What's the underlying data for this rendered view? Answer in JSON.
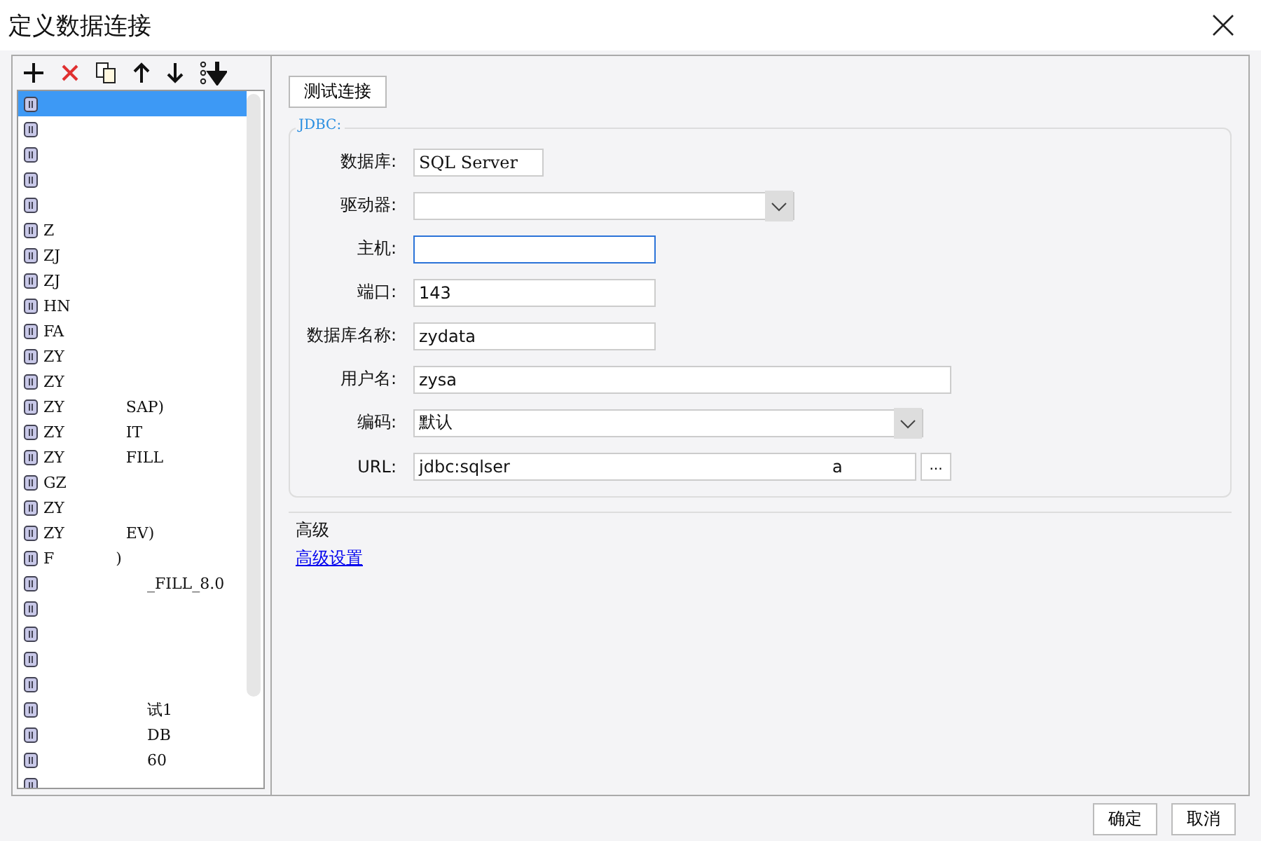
{
  "window": {
    "title": "定义数据连接"
  },
  "connections": [
    {
      "selected": true
    },
    {
      "selected": false
    },
    {
      "selected": false
    },
    {
      "selected": false
    },
    {
      "selected": false
    },
    {
      "selected": false,
      "start": "Z"
    },
    {
      "selected": false,
      "start": "ZJ"
    },
    {
      "selected": false,
      "start": "ZJ"
    },
    {
      "selected": false,
      "start": "HN"
    },
    {
      "selected": false,
      "start": "FA"
    },
    {
      "selected": false,
      "start": "ZY"
    },
    {
      "selected": false,
      "start": "ZY"
    },
    {
      "selected": false,
      "start": "ZY",
      "end": "SAP)"
    },
    {
      "selected": false,
      "start": "ZY",
      "end": "IT"
    },
    {
      "selected": false,
      "start": "ZY",
      "end": "FILL"
    },
    {
      "selected": false,
      "start": "GZ"
    },
    {
      "selected": false,
      "start": "ZY"
    },
    {
      "selected": false,
      "start": "ZY",
      "end": "EV)"
    },
    {
      "selected": false,
      "start": "F",
      "end": ")"
    },
    {
      "selected": false,
      "end": "_FILL_8.0"
    },
    {
      "selected": false
    },
    {
      "selected": false
    },
    {
      "selected": false
    },
    {
      "selected": false
    },
    {
      "selected": false,
      "end": "试1"
    },
    {
      "selected": false,
      "end": "DB"
    },
    {
      "selected": false,
      "end": "60"
    },
    {
      "selected": false
    }
  ],
  "test_button": "测试连接",
  "jdbc": {
    "legend": "JDBC:",
    "fields": [
      {
        "kind": "readonly",
        "label": "数据库:",
        "value": "SQL Server"
      },
      {
        "kind": "select",
        "label": "驱动器:"
      },
      {
        "kind": "input",
        "label": "主机:",
        "focused": true
      },
      {
        "kind": "input",
        "label": "端口:",
        "value": "143"
      },
      {
        "kind": "input",
        "label": "数据库名称:",
        "value": "zydata"
      },
      {
        "kind": "wide",
        "label": "用户名:",
        "value": "zysa"
      },
      {
        "kind": "wideselect",
        "label": "编码:",
        "value": "默认"
      },
      {
        "kind": "url",
        "label": "URL:",
        "value": "jdbc:sqlser",
        "tail": "a",
        "button": "..."
      }
    ]
  },
  "advanced": {
    "heading": "高级",
    "link": "高级设置"
  },
  "buttons": [
    "确定",
    "取消"
  ]
}
